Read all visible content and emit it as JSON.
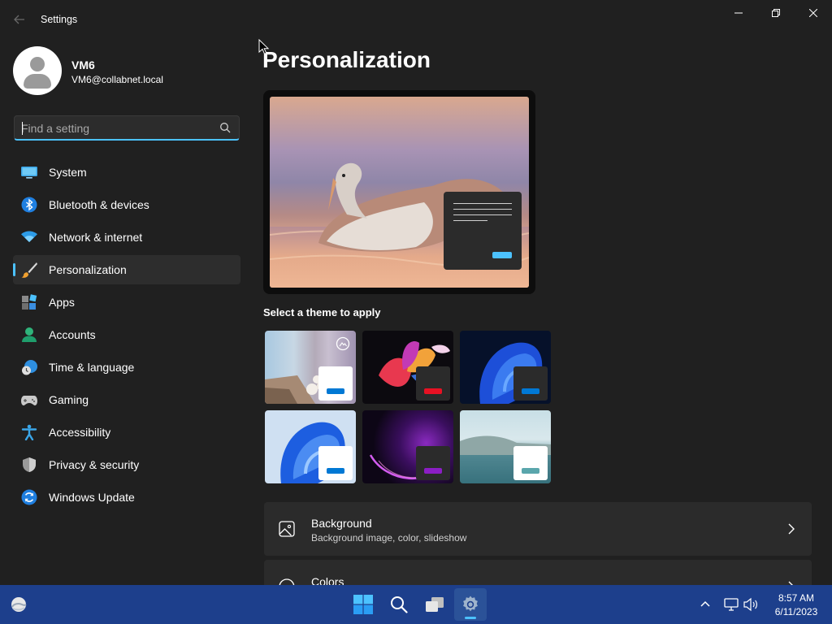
{
  "window": {
    "title": "Settings"
  },
  "profile": {
    "name": "VM6",
    "email": "VM6@collabnet.local"
  },
  "search": {
    "placeholder": "Find a setting"
  },
  "nav": {
    "items": [
      {
        "label": "System",
        "icon": "monitor-icon"
      },
      {
        "label": "Bluetooth & devices",
        "icon": "bluetooth-icon"
      },
      {
        "label": "Network & internet",
        "icon": "wifi-icon"
      },
      {
        "label": "Personalization",
        "icon": "paintbrush-icon",
        "active": true
      },
      {
        "label": "Apps",
        "icon": "apps-icon"
      },
      {
        "label": "Accounts",
        "icon": "person-icon"
      },
      {
        "label": "Time & language",
        "icon": "clock-globe-icon"
      },
      {
        "label": "Gaming",
        "icon": "gamepad-icon"
      },
      {
        "label": "Accessibility",
        "icon": "accessibility-icon"
      },
      {
        "label": "Privacy & security",
        "icon": "shield-icon"
      },
      {
        "label": "Windows Update",
        "icon": "update-icon"
      }
    ]
  },
  "main": {
    "title": "Personalization",
    "theme_section_label": "Select a theme to apply",
    "themes": [
      {
        "name": "theme-1",
        "accent": "#0078d4"
      },
      {
        "name": "theme-2",
        "accent": "#e81123"
      },
      {
        "name": "theme-3",
        "accent": "#0078d4"
      },
      {
        "name": "theme-4",
        "accent": "#0078d4"
      },
      {
        "name": "theme-5",
        "accent": "#8b1ec4"
      },
      {
        "name": "theme-6",
        "accent": "#5aa6ac"
      }
    ],
    "cards": [
      {
        "title": "Background",
        "subtitle": "Background image, color, slideshow",
        "icon": "image-icon"
      },
      {
        "title": "Colors",
        "subtitle": "",
        "icon": "palette-icon"
      }
    ]
  },
  "taskbar": {
    "items": [
      "widgets-icon",
      "start-icon",
      "search-icon",
      "task-view-icon",
      "settings-icon"
    ],
    "clock": {
      "time": "8:57 AM",
      "date": "6/11/2023"
    }
  },
  "colors": {
    "accent": "#4cc2ff",
    "taskbar": "#1d3f8c",
    "background": "#202020"
  }
}
